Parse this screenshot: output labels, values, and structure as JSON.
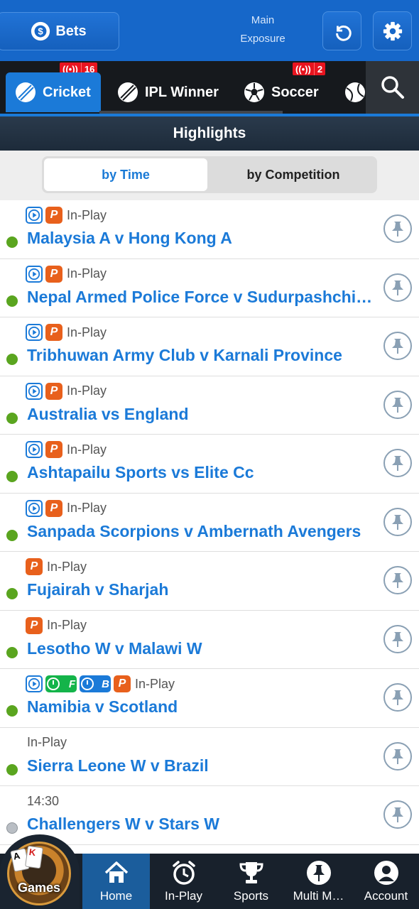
{
  "header": {
    "bets_label": "Bets",
    "exposure_line1": "Main",
    "exposure_line2": "Exposure"
  },
  "sport_tabs": [
    {
      "label": "Cricket",
      "live_count": "16",
      "active": true
    },
    {
      "label": "IPL Winner"
    },
    {
      "label": "Soccer",
      "live_count": "2"
    }
  ],
  "section_title": "Highlights",
  "sort_options": {
    "by_time": "by Time",
    "by_competition": "by Competition",
    "selected": "by Time"
  },
  "events": [
    {
      "status": "In-Play",
      "name": "Malaysia A v Hong Kong A",
      "badges": [
        "stream",
        "premium"
      ]
    },
    {
      "status": "In-Play",
      "name": "Nepal Armed Police Force v Sudurpashchim Province",
      "badges": [
        "stream",
        "premium"
      ]
    },
    {
      "status": "In-Play",
      "name": "Tribhuwan Army Club v Karnali Province",
      "badges": [
        "stream",
        "premium"
      ]
    },
    {
      "status": "In-Play",
      "name": "Australia vs England",
      "badges": [
        "stream",
        "premium"
      ]
    },
    {
      "status": "In-Play",
      "name": "Ashtapailu Sports vs Elite Cc",
      "badges": [
        "stream",
        "premium"
      ]
    },
    {
      "status": "In-Play",
      "name": "Sanpada Scorpions v Ambernath Avengers",
      "badges": [
        "stream",
        "premium"
      ]
    },
    {
      "status": "In-Play",
      "name": "Fujairah v Sharjah",
      "badges": [
        "premium"
      ]
    },
    {
      "status": "In-Play",
      "name": "Lesotho W v Malawi W",
      "badges": [
        "premium"
      ]
    },
    {
      "status": "In-Play",
      "name": "Namibia v Scotland",
      "badges": [
        "stream",
        "fancy",
        "bookmaker",
        "premium"
      ],
      "fancy_letter": "F",
      "book_letter": "B"
    },
    {
      "status": "In-Play",
      "name": "Sierra Leone W v Brazil",
      "badges": []
    },
    {
      "status": "14:30",
      "name": "Challengers W v Stars W",
      "badges": [],
      "upcoming": true
    }
  ],
  "bottom_nav": {
    "games": "Games",
    "home": "Home",
    "inplay": "In-Play",
    "sports": "Sports",
    "multi": "Multi M…",
    "account": "Account"
  },
  "colors": {
    "brand_blue": "#1667c9",
    "link_blue": "#1b7ad8",
    "live_green": "#5aa51f",
    "live_red": "#e8141f"
  }
}
